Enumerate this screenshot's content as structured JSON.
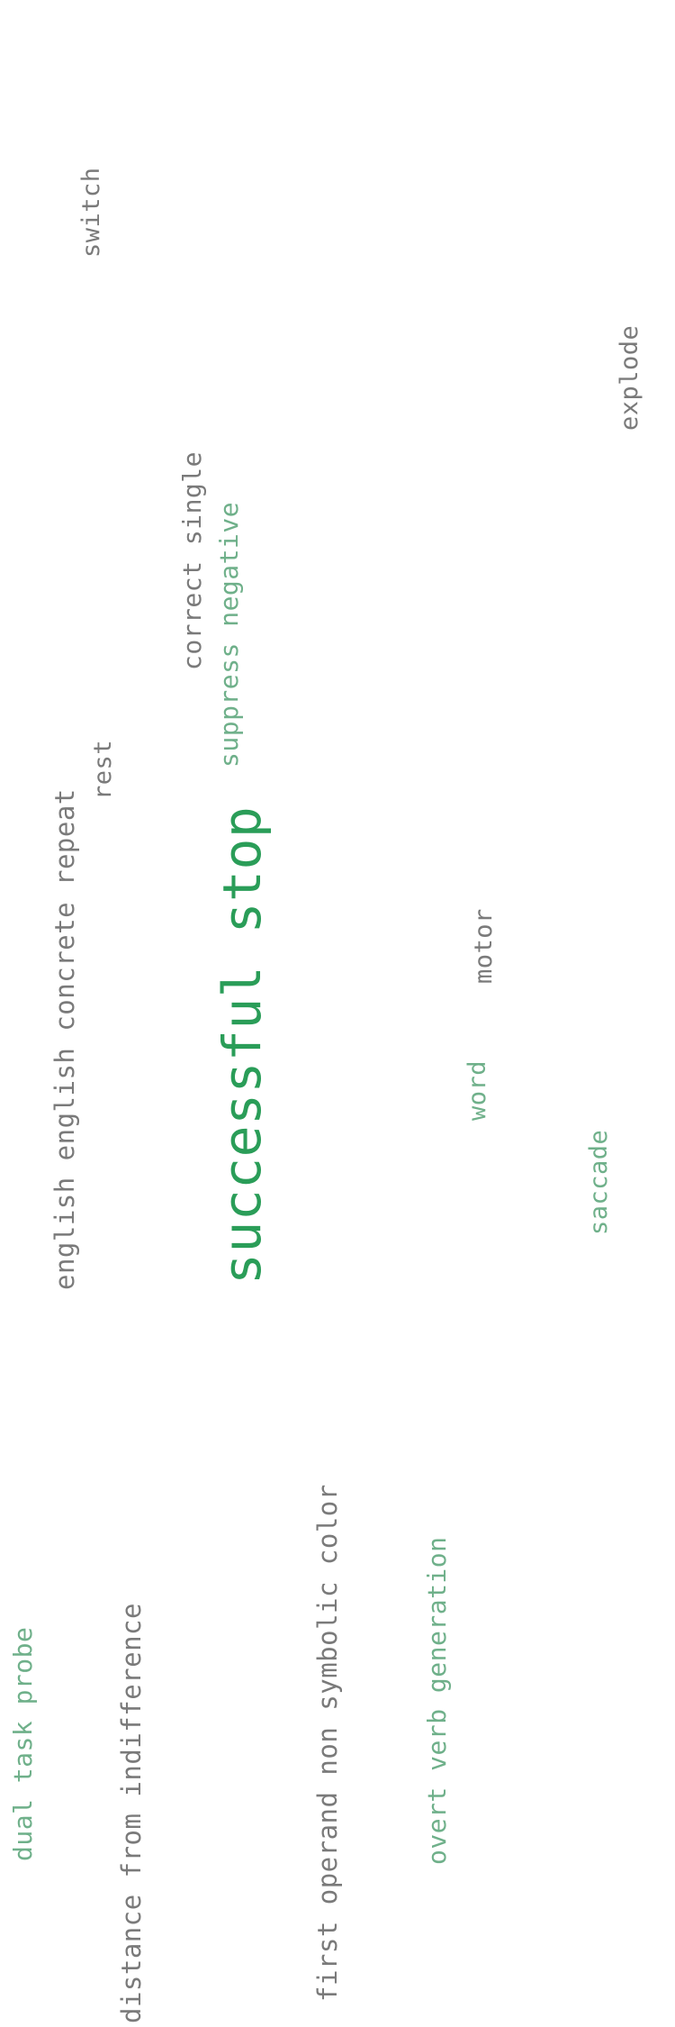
{
  "palette": {
    "gray": "#7a7a7a",
    "green": "#2a9d58",
    "green_light": "#6fb08a"
  },
  "words": {
    "switch": "switch",
    "explode": "explode",
    "correct_single": "correct single",
    "suppress_negative": "suppress negative",
    "rest": "rest",
    "english_concrete_repeat": "english english concrete repeat",
    "successful_stop": "successful stop",
    "motor": "motor",
    "word": "word",
    "saccade": "saccade",
    "first_operand": "first operand non symbolic color",
    "overt_verb_generation": "overt verb generation",
    "distance_from_indifference": "distance from indifference",
    "dual_task_probe": "dual task probe"
  }
}
